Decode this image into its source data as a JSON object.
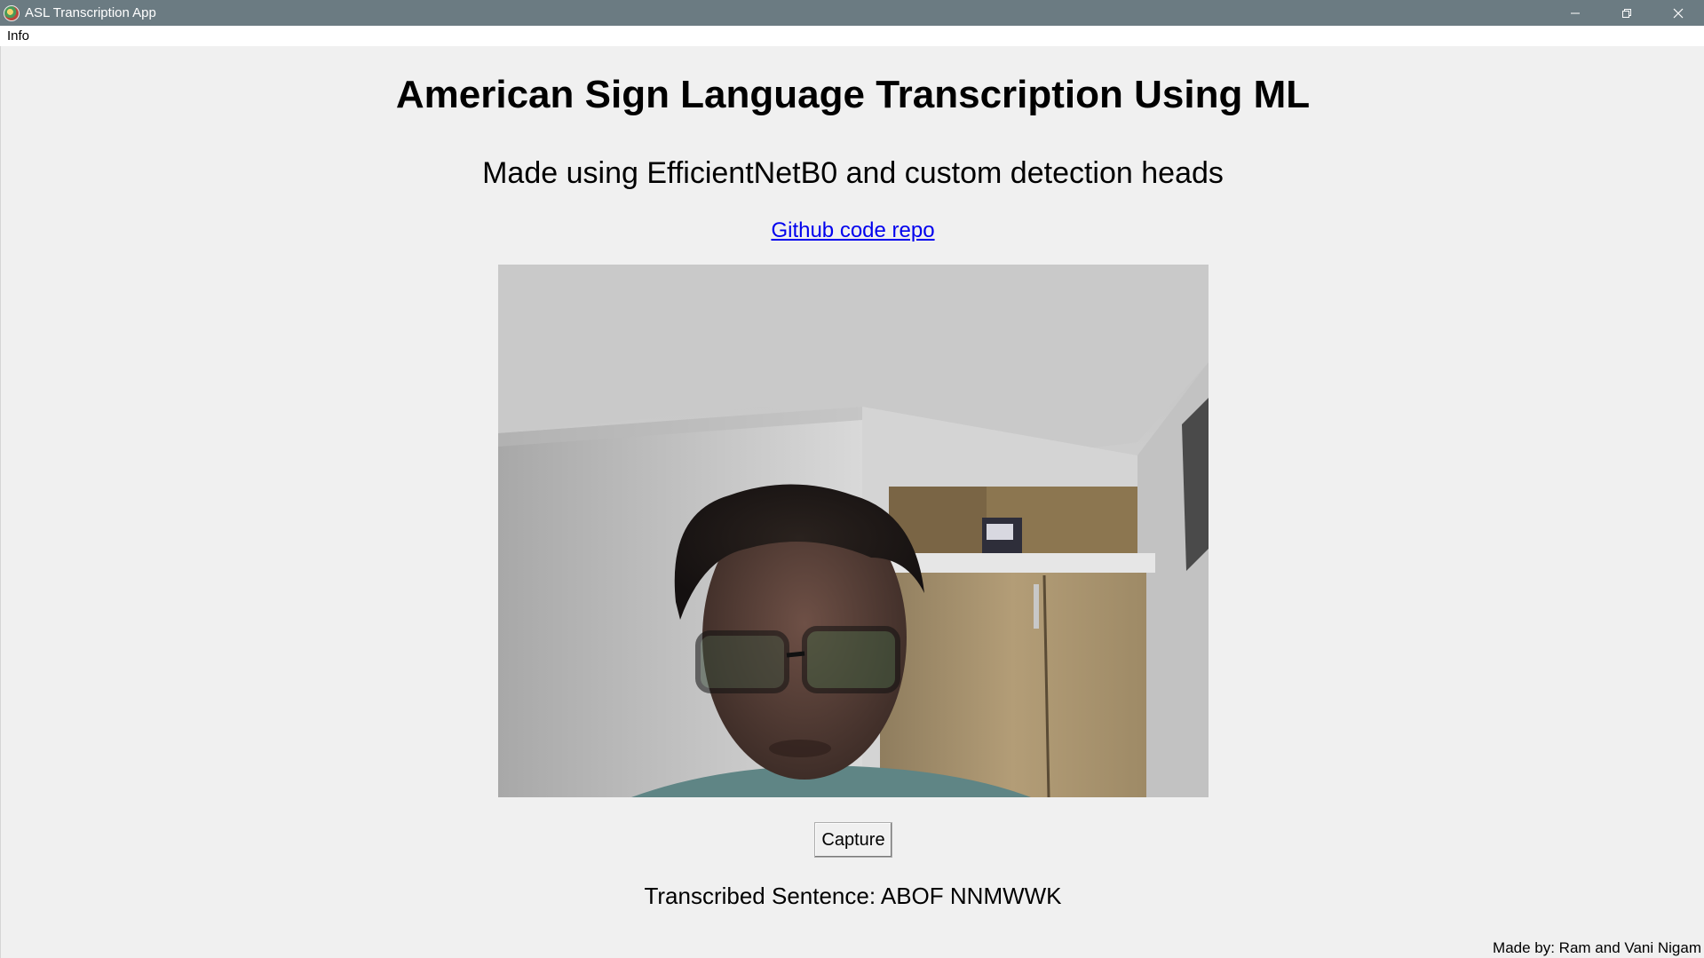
{
  "window": {
    "title": "ASL Transcription App",
    "controls": [
      "minimize",
      "restore",
      "close"
    ]
  },
  "menubar": {
    "items": [
      {
        "label": "Info"
      }
    ]
  },
  "main": {
    "heading": "American Sign Language Transcription Using ML",
    "subheading": "Made using EfficientNetB0 and custom detection heads",
    "link_label": "Github code repo",
    "capture_label": "Capture",
    "transcription_label": "Transcribed Sentence:",
    "transcription_value": "ABOF NNMWWK",
    "footer": "Made by: Ram and Vani Nigam"
  },
  "colors": {
    "titlebar": "#6b7b82",
    "background": "#f0f0f0",
    "link": "#0000ee"
  }
}
